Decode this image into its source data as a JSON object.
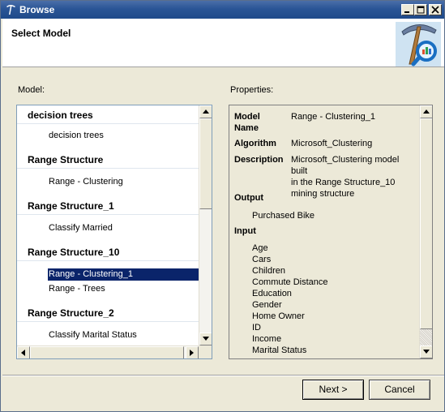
{
  "window": {
    "title": "Browse",
    "colors": {
      "titlebar": "#2a5596",
      "selection": "#0a246a",
      "face": "#ece9d8"
    },
    "controls": [
      "minimize-icon",
      "maximize-icon",
      "close-icon"
    ]
  },
  "header": {
    "title": "Select Model",
    "icon": "data-mining-pickaxe-icon"
  },
  "models": {
    "label": "Model:",
    "groups": [
      {
        "name": "decision trees",
        "items": [
          "decision trees"
        ]
      },
      {
        "name": "Range Structure",
        "items": [
          "Range - Clustering"
        ]
      },
      {
        "name": "Range Structure_1",
        "items": [
          "Classify Married"
        ]
      },
      {
        "name": "Range Structure_10",
        "items": [
          "Range - Clustering_1",
          "Range - Trees"
        ]
      },
      {
        "name": "Range Structure_2",
        "items": [
          "Classify Marital Status"
        ]
      }
    ],
    "selected": "Range - Clustering_1"
  },
  "properties": {
    "label": "Properties:",
    "model_name_key": "Model Name",
    "model_name_key_line1": "Model",
    "model_name_key_line2": "Name",
    "model_name": "Range - Clustering_1",
    "algorithm_key": "Algorithm",
    "algorithm": "Microsoft_Clustering",
    "description_key": "Description",
    "description_line1": "Microsoft_Clustering model built",
    "description_line2": "in the Range Structure_10",
    "description_line3": "mining structure",
    "output_label": "Output",
    "output": [
      "Purchased Bike"
    ],
    "input_label": "Input",
    "input": [
      "Age",
      "Cars",
      "Children",
      "Commute Distance",
      "Education",
      "Gender",
      "Home Owner",
      "ID",
      "Income",
      "Marital Status"
    ]
  },
  "buttons": {
    "next": "Next >",
    "cancel": "Cancel"
  }
}
